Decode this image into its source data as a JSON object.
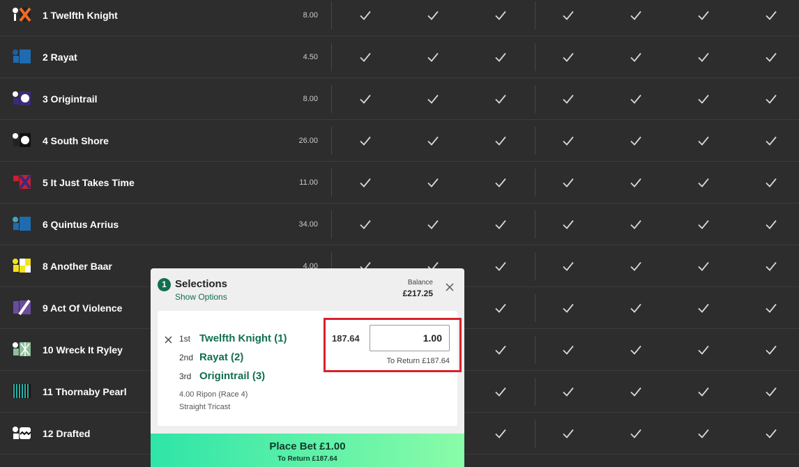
{
  "runners": [
    {
      "number": "1",
      "name": "Twelfth Knight",
      "odds": "8.00",
      "silk": "silk-black-orange-cross-icon"
    },
    {
      "number": "2",
      "name": "Rayat",
      "odds": "4.50",
      "silk": "silk-blue-icon"
    },
    {
      "number": "3",
      "name": "Origintrail",
      "odds": "8.00",
      "silk": "silk-purple-white-dot-icon"
    },
    {
      "number": "4",
      "name": "South Shore",
      "odds": "26.00",
      "silk": "silk-black-white-dot-icon"
    },
    {
      "number": "5",
      "name": "It Just Takes Time",
      "odds": "11.00",
      "silk": "silk-red-purple-cross-icon"
    },
    {
      "number": "6",
      "name": "Quintus Arrius",
      "odds": "34.00",
      "silk": "silk-blue-teal-icon"
    },
    {
      "number": "8",
      "name": "Another Baar",
      "odds": "4.00",
      "silk": "silk-yellow-white-check-icon"
    },
    {
      "number": "9",
      "name": "Act Of Violence",
      "odds": "",
      "silk": "silk-purple-white-sash-icon"
    },
    {
      "number": "10",
      "name": "Wreck It Ryley",
      "odds": "",
      "silk": "silk-green-white-diamond-icon"
    },
    {
      "number": "11",
      "name": "Thornaby Pearl",
      "odds": "",
      "silk": "silk-teal-black-stripe-icon"
    },
    {
      "number": "12",
      "name": "Drafted",
      "odds": "",
      "silk": "silk-white-black-diamond-icon"
    }
  ],
  "betslip": {
    "count": "1",
    "title": "Selections",
    "show_options": "Show Options",
    "balance_label": "Balance",
    "balance_value": "£217.25",
    "picks": [
      {
        "position": "1st",
        "selection": "Twelfth Knight (1)"
      },
      {
        "position": "2nd",
        "selection": "Rayat (2)"
      },
      {
        "position": "3rd",
        "selection": "Origintrail (3)"
      }
    ],
    "race": "4.00 Ripon (Race 4)",
    "bet_type": "Straight Tricast",
    "odds": "187.64",
    "stake": "1.00",
    "to_return": "To Return £187.64",
    "place_bet": "Place Bet  £1.00",
    "place_to_return": "To Return £187.64"
  },
  "colors": {
    "accent": "#126e51",
    "highlight": "#d9202c",
    "button_start": "#2ee5a8",
    "button_end": "#8afca8"
  }
}
